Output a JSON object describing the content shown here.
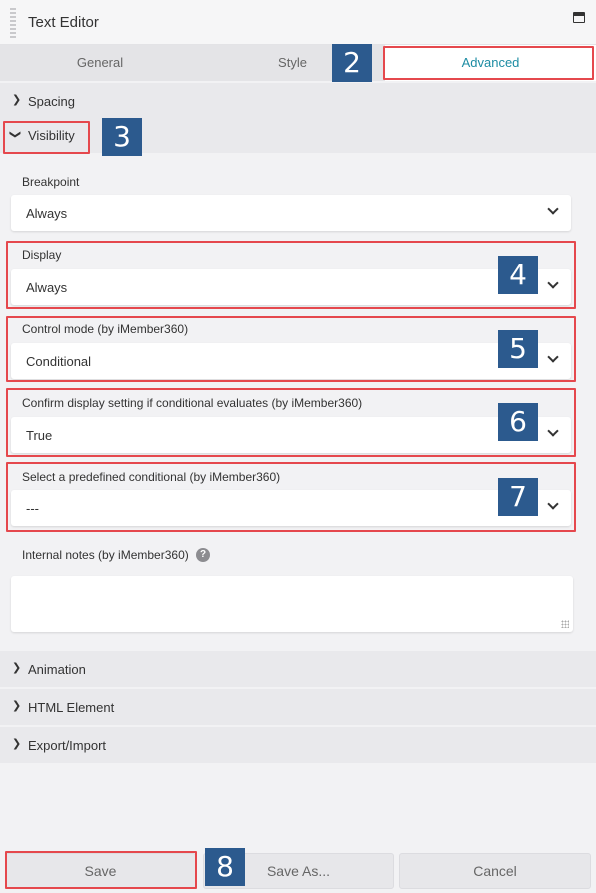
{
  "header": {
    "title": "Text Editor",
    "maximize_icon": "window-maximize-icon"
  },
  "tabs": [
    {
      "label": "General"
    },
    {
      "label": "Style"
    },
    {
      "label": "Advanced",
      "active": true
    }
  ],
  "sections": {
    "spacing": "Spacing",
    "visibility": "Visibility",
    "animation": "Animation",
    "html_element": "HTML Element",
    "export_import": "Export/Import"
  },
  "fields": {
    "breakpoint": {
      "label": "Breakpoint",
      "value": "Always"
    },
    "display": {
      "label": "Display",
      "value": "Always"
    },
    "control_mode": {
      "label": "Control mode (by iMember360)",
      "value": "Conditional"
    },
    "confirm_display": {
      "label": "Confirm display setting if conditional evaluates (by iMember360)",
      "value": "True"
    },
    "predefined": {
      "label": "Select a predefined conditional (by iMember360)",
      "value": "---"
    },
    "notes": {
      "label": "Internal notes (by iMember360)",
      "help": "?"
    }
  },
  "badges": {
    "b2": "2",
    "b3": "3",
    "b4": "4",
    "b5": "5",
    "b6": "6",
    "b7": "7",
    "b8": "8"
  },
  "buttons": {
    "save": "Save",
    "save_as": "Save As...",
    "cancel": "Cancel"
  },
  "colors": {
    "accent": "#1d8ca3",
    "highlight": "#e5484d",
    "badge": "#2c5a8e"
  }
}
